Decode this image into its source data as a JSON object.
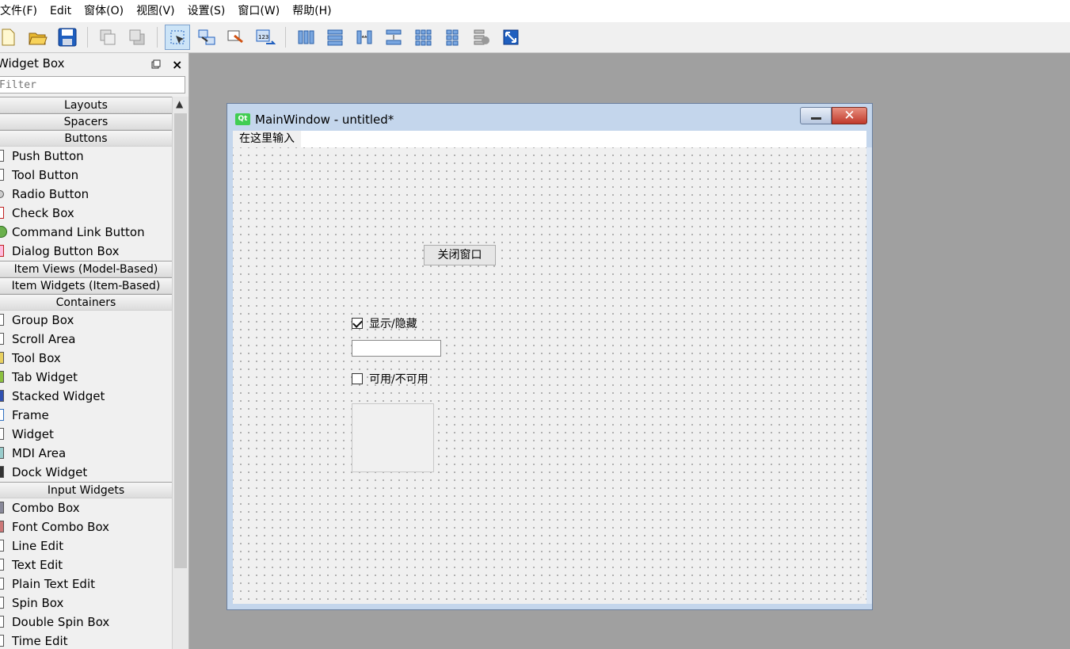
{
  "menubar": {
    "items": [
      "文件(F)",
      "Edit",
      "窗体(O)",
      "视图(V)",
      "设置(S)",
      "窗口(W)",
      "帮助(H)"
    ]
  },
  "toolbar": {
    "buttons": [
      "new-icon",
      "open-icon",
      "save-icon",
      "bring-front-icon",
      "send-back-icon",
      "edit-widgets-icon",
      "edit-signals-icon",
      "edit-buddies-icon",
      "edit-tab-order-icon",
      "layout-horizontal-icon",
      "layout-vertical-icon",
      "layout-h-splitter-icon",
      "layout-v-splitter-icon",
      "layout-form-icon",
      "layout-grid-icon",
      "break-layout-icon",
      "adjust-size-icon"
    ],
    "active": "edit-widgets-icon"
  },
  "widget_box": {
    "title": "Widget Box",
    "filter_placeholder": "Filter",
    "float_icon": "float-icon",
    "close_icon": "×",
    "sections": [
      {
        "label": "Layouts",
        "items": []
      },
      {
        "label": "Spacers",
        "items": []
      },
      {
        "label": "Buttons",
        "items": [
          "Push Button",
          "Tool Button",
          "Radio Button",
          "Check Box",
          "Command Link Button",
          "Dialog Button Box"
        ]
      },
      {
        "label": "Item Views (Model-Based)",
        "items": []
      },
      {
        "label": "Item Widgets (Item-Based)",
        "items": []
      },
      {
        "label": "Containers",
        "items": [
          "Group Box",
          "Scroll Area",
          "Tool Box",
          "Tab Widget",
          "Stacked Widget",
          "Frame",
          "Widget",
          "MDI Area",
          "Dock Widget"
        ]
      },
      {
        "label": "Input Widgets",
        "items": [
          "Combo Box",
          "Font Combo Box",
          "Line Edit",
          "Text Edit",
          "Plain Text Edit",
          "Spin Box",
          "Double Spin Box",
          "Time Edit"
        ]
      }
    ]
  },
  "main_window": {
    "logo": "Qt",
    "title": "MainWindow - untitled*",
    "close_glyph": "✕",
    "menu_placeholder": "在这里输入",
    "push_button_label": "关闭窗口",
    "checkbox_show": {
      "label": "显示/隐藏",
      "checked": true
    },
    "checkbox_enable": {
      "label": "可用/不可用",
      "checked": false
    },
    "line_edit_value": ""
  },
  "colors": {
    "canvas_bg": "#a0a0a0",
    "panel_bg": "#f0f0f0",
    "titlebar": "#c4d6ec",
    "close_button": "#c0392b",
    "qt_green": "#41cd52"
  }
}
